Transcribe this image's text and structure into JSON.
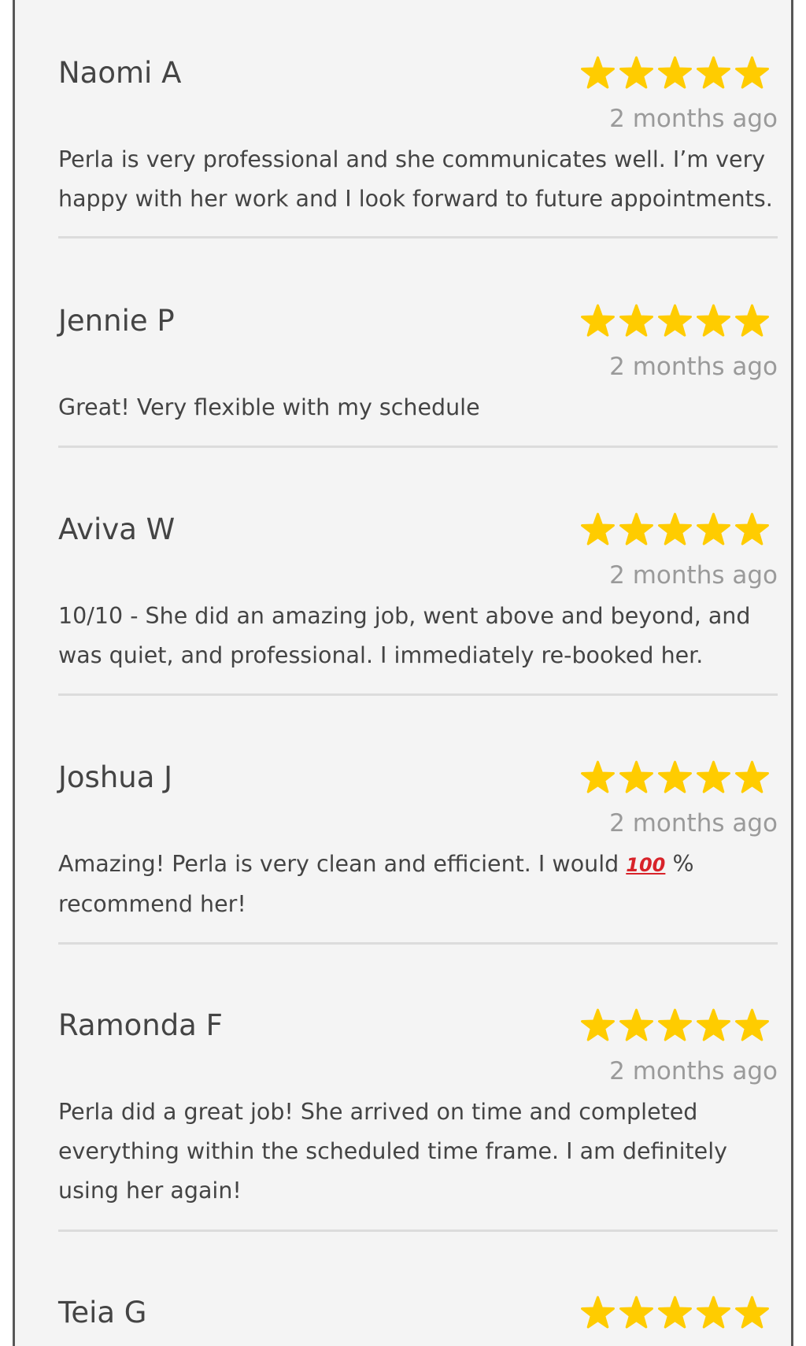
{
  "reviews": [
    {
      "name": "Naomi A",
      "rating": 5,
      "time": "2 months ago",
      "text": "Perla is very professional and she communicates well. I’m very happy with her work and I look forward to future appointments."
    },
    {
      "name": "Jennie P",
      "rating": 5,
      "time": "2 months ago",
      "text": "Great! Very flexible with my schedule"
    },
    {
      "name": "Aviva W",
      "rating": 5,
      "time": "2 months ago",
      "text": "10/10 - She did an amazing job, went above and beyond, and was quiet, and professional. I immediately re-booked her."
    },
    {
      "name": "Joshua J",
      "rating": 5,
      "time": "2 months ago",
      "text_before": "Amazing! Perla is very clean and efficient. I would ",
      "emoji": "100",
      "text_after": " % recommend her!"
    },
    {
      "name": "Ramonda F",
      "rating": 5,
      "time": "2 months ago",
      "text": "Perla did a great job! She arrived on time and completed everything within the scheduled time frame. I am definitely using her again!"
    },
    {
      "name": "Teia G",
      "rating": 5
    }
  ],
  "colors": {
    "star": "#ffcc00",
    "name_text": "#444444",
    "time_text": "#9a9a9a",
    "divider": "#dcdcdc",
    "background": "#f4f4f4"
  },
  "icons": {
    "star": "star-icon",
    "hundred": "hundred-points-icon"
  }
}
